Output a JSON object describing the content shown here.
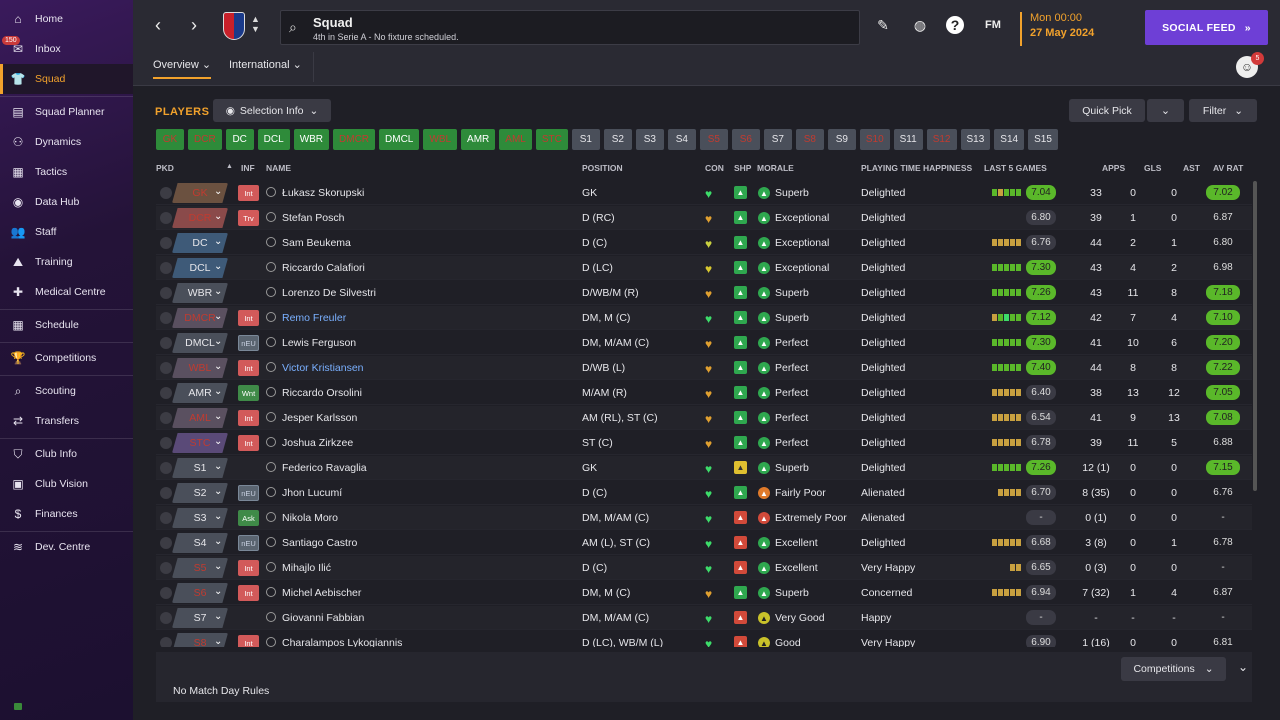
{
  "sidebar": {
    "items": [
      {
        "label": "Home",
        "icon": "home-icon",
        "glyph": "⌂"
      },
      {
        "label": "Inbox",
        "icon": "inbox-icon",
        "glyph": "✉",
        "badge": "150"
      },
      {
        "label": "Squad",
        "icon": "squad-icon",
        "glyph": "👕",
        "active": true
      },
      {
        "label": "Squad Planner",
        "icon": "planner-icon",
        "glyph": "▤"
      },
      {
        "label": "Dynamics",
        "icon": "dynamics-icon",
        "glyph": "⚇"
      },
      {
        "label": "Tactics",
        "icon": "tactics-icon",
        "glyph": "▦"
      },
      {
        "label": "Data Hub",
        "icon": "datahub-icon",
        "glyph": "◉"
      },
      {
        "label": "Staff",
        "icon": "staff-icon",
        "glyph": "👥"
      },
      {
        "label": "Training",
        "icon": "training-icon",
        "glyph": "⛰"
      },
      {
        "label": "Medical Centre",
        "icon": "medical-icon",
        "glyph": "✚"
      },
      {
        "label": "Schedule",
        "icon": "schedule-icon",
        "glyph": "▦"
      },
      {
        "label": "Competitions",
        "icon": "trophy-icon",
        "glyph": "🏆"
      },
      {
        "label": "Scouting",
        "icon": "scouting-icon",
        "glyph": "⌕"
      },
      {
        "label": "Transfers",
        "icon": "transfers-icon",
        "glyph": "⇄"
      },
      {
        "label": "Club Info",
        "icon": "shield-icon",
        "glyph": "⛉"
      },
      {
        "label": "Club Vision",
        "icon": "vision-icon",
        "glyph": "▣"
      },
      {
        "label": "Finances",
        "icon": "finances-icon",
        "glyph": "$"
      },
      {
        "label": "Dev. Centre",
        "icon": "devcentre-icon",
        "glyph": "≋"
      }
    ]
  },
  "header": {
    "title": "Squad",
    "subtitle": "4th in Serie A - No fixture scheduled.",
    "date_time": "Mon 00:00",
    "date": "27 May 2024",
    "social_feed": "SOCIAL FEED",
    "fm_label": "FM",
    "notif_count": "5"
  },
  "tabs": [
    "Overview",
    "International"
  ],
  "toolbar": {
    "players_label": "PLAYERS",
    "selection_info": "Selection Info",
    "quick_pick": "Quick Pick",
    "filter": "Filter"
  },
  "positions": [
    {
      "l": "GK",
      "s": "gr"
    },
    {
      "l": "DCR",
      "s": "gr"
    },
    {
      "l": "DC",
      "s": "g"
    },
    {
      "l": "DCL",
      "s": "g"
    },
    {
      "l": "WBR",
      "s": "g"
    },
    {
      "l": "DMCR",
      "s": "gr"
    },
    {
      "l": "DMCL",
      "s": "g"
    },
    {
      "l": "WBL",
      "s": "gr"
    },
    {
      "l": "AMR",
      "s": "g"
    },
    {
      "l": "AML",
      "s": "gr"
    },
    {
      "l": "STC",
      "s": "gr"
    },
    {
      "l": "S1",
      "s": "n"
    },
    {
      "l": "S2",
      "s": "n"
    },
    {
      "l": "S3",
      "s": "n"
    },
    {
      "l": "S4",
      "s": "n"
    },
    {
      "l": "S5",
      "s": "nr"
    },
    {
      "l": "S6",
      "s": "nr"
    },
    {
      "l": "S7",
      "s": "n"
    },
    {
      "l": "S8",
      "s": "nr"
    },
    {
      "l": "S9",
      "s": "n"
    },
    {
      "l": "S10",
      "s": "nr"
    },
    {
      "l": "S11",
      "s": "n"
    },
    {
      "l": "S12",
      "s": "nr"
    },
    {
      "l": "S13",
      "s": "n"
    },
    {
      "l": "S14",
      "s": "n"
    },
    {
      "l": "S15",
      "s": "n"
    }
  ],
  "columns": [
    "PKD",
    "INF",
    "NAME",
    "POSITION",
    "CON",
    "SHP",
    "MORALE",
    "PLAYING TIME HAPPINESS",
    "LAST 5 GAMES",
    "APPS",
    "GLS",
    "AST",
    "AV RAT"
  ],
  "players": [
    {
      "pkd": "GK",
      "pc": "pc-brown",
      "inf": "Int",
      "infc": "r",
      "name": "Łukasz Skorupski",
      "pos": "GK",
      "con": "#3ddc6a",
      "shp": "g",
      "mor": "Superb",
      "morc": "g",
      "happy": "Delighted",
      "bars": [
        "#5ab82a",
        "#c8a040",
        "#5ab82a",
        "#5ab82a",
        "#5ab82a"
      ],
      "rat": "7.04",
      "ratc": "g",
      "apps": "33",
      "gls": "0",
      "ast": "0",
      "av": "7.02",
      "avc": "g"
    },
    {
      "pkd": "DCR",
      "pc": "pc-red",
      "inf": "Trv",
      "infc": "r",
      "name": "Stefan Posch",
      "pos": "D (RC)",
      "con": "#e0a030",
      "shp": "g",
      "mor": "Exceptional",
      "morc": "g",
      "happy": "Delighted",
      "bars": [],
      "rat": "6.80",
      "ratc": "n",
      "apps": "39",
      "gls": "1",
      "ast": "0",
      "av": "6.87",
      "avc": "n"
    },
    {
      "pkd": "DC",
      "pc": "pc-blue",
      "inf": "",
      "infc": "",
      "name": "Sam Beukema",
      "pos": "D (C)",
      "con": "#c9d040",
      "shp": "g",
      "mor": "Exceptional",
      "morc": "g",
      "happy": "Delighted",
      "bars": [
        "#c8a040",
        "#c8a040",
        "#c8a040",
        "#c8a040",
        "#c8a040"
      ],
      "rat": "6.76",
      "ratc": "n",
      "apps": "44",
      "gls": "2",
      "ast": "1",
      "av": "6.80",
      "avc": "n"
    },
    {
      "pkd": "DCL",
      "pc": "pc-blue",
      "inf": "",
      "infc": "",
      "name": "Riccardo Calafiori",
      "pos": "D (LC)",
      "con": "#d8c830",
      "shp": "g",
      "mor": "Exceptional",
      "morc": "g",
      "happy": "Delighted",
      "bars": [
        "#5ab82a",
        "#5ab82a",
        "#5ab82a",
        "#5ab82a",
        "#5ab82a"
      ],
      "rat": "7.30",
      "ratc": "g",
      "apps": "43",
      "gls": "4",
      "ast": "2",
      "av": "6.98",
      "avc": "n"
    },
    {
      "pkd": "WBR",
      "pc": "pc-grey",
      "inf": "",
      "infc": "",
      "name": "Lorenzo De Silvestri",
      "pos": "D/WB/M (R)",
      "con": "#e0a030",
      "shp": "g",
      "mor": "Superb",
      "morc": "g",
      "happy": "Delighted",
      "bars": [
        "#5ab82a",
        "#5ab82a",
        "#5ab82a",
        "#5ab82a",
        "#5ab82a"
      ],
      "rat": "7.26",
      "ratc": "g",
      "apps": "43",
      "gls": "11",
      "ast": "8",
      "av": "7.18",
      "avc": "g"
    },
    {
      "pkd": "DMCR",
      "pc": "pc-redgrey",
      "inf": "Int",
      "infc": "r",
      "name": "Remo Freuler",
      "blue": true,
      "pos": "DM, M (C)",
      "con": "#3ddc6a",
      "shp": "g",
      "mor": "Superb",
      "morc": "g",
      "happy": "Delighted",
      "bars": [
        "#c8a040",
        "#5ab82a",
        "#3ddc6a",
        "#5ab82a",
        "#5ab82a"
      ],
      "rat": "7.12",
      "ratc": "g",
      "apps": "42",
      "gls": "7",
      "ast": "4",
      "av": "7.10",
      "avc": "g"
    },
    {
      "pkd": "DMCL",
      "pc": "pc-grey",
      "inf": "nEU",
      "infc": "b",
      "name": "Lewis Ferguson",
      "pos": "DM, M/AM (C)",
      "con": "#e0a030",
      "shp": "g",
      "mor": "Perfect",
      "morc": "g",
      "happy": "Delighted",
      "bars": [
        "#5ab82a",
        "#5ab82a",
        "#5ab82a",
        "#5ab82a",
        "#5ab82a"
      ],
      "rat": "7.30",
      "ratc": "g",
      "apps": "41",
      "gls": "10",
      "ast": "6",
      "av": "7.20",
      "avc": "g"
    },
    {
      "pkd": "WBL",
      "pc": "pc-redgrey",
      "inf": "Int",
      "infc": "r",
      "name": "Victor Kristiansen",
      "blue": true,
      "pos": "D/WB (L)",
      "con": "#e0a030",
      "shp": "g",
      "mor": "Perfect",
      "morc": "g",
      "happy": "Delighted",
      "bars": [
        "#5ab82a",
        "#5ab82a",
        "#5ab82a",
        "#5ab82a",
        "#5ab82a"
      ],
      "rat": "7.40",
      "ratc": "g",
      "apps": "44",
      "gls": "8",
      "ast": "8",
      "av": "7.22",
      "avc": "g"
    },
    {
      "pkd": "AMR",
      "pc": "pc-grey",
      "inf": "Wnt",
      "infc": "g",
      "name": "Riccardo Orsolini",
      "pos": "M/AM (R)",
      "con": "#e0a030",
      "shp": "g",
      "mor": "Perfect",
      "morc": "g",
      "happy": "Delighted",
      "bars": [
        "#c8a040",
        "#c8a040",
        "#c8a040",
        "#c8a040",
        "#c8a040"
      ],
      "rat": "6.40",
      "ratc": "n",
      "apps": "38",
      "gls": "13",
      "ast": "12",
      "av": "7.05",
      "avc": "g"
    },
    {
      "pkd": "AML",
      "pc": "pc-redgrey",
      "inf": "Int",
      "infc": "r",
      "name": "Jesper Karlsson",
      "pos": "AM (RL), ST (C)",
      "con": "#e0a030",
      "shp": "g",
      "mor": "Perfect",
      "morc": "g",
      "happy": "Delighted",
      "bars": [
        "#c8a040",
        "#c8a040",
        "#c8a040",
        "#c8a040",
        "#c8a040"
      ],
      "rat": "6.54",
      "ratc": "n",
      "apps": "41",
      "gls": "9",
      "ast": "13",
      "av": "7.08",
      "avc": "g"
    },
    {
      "pkd": "STC",
      "pc": "pc-purp",
      "inf": "Int",
      "infc": "r",
      "name": "Joshua Zirkzee",
      "pos": "ST (C)",
      "con": "#e0a030",
      "shp": "g",
      "mor": "Perfect",
      "morc": "g",
      "happy": "Delighted",
      "bars": [
        "#c8a040",
        "#c8a040",
        "#c8a040",
        "#c8a040",
        "#c8a040"
      ],
      "rat": "6.78",
      "ratc": "n",
      "apps": "39",
      "gls": "11",
      "ast": "5",
      "av": "6.88",
      "avc": "n"
    },
    {
      "pkd": "S1",
      "pc": "pc-grey",
      "inf": "",
      "infc": "",
      "name": "Federico Ravaglia",
      "pos": "GK",
      "con": "#3ddc6a",
      "shp": "y",
      "mor": "Superb",
      "morc": "g",
      "happy": "Delighted",
      "bars": [
        "#5ab82a",
        "#5ab82a",
        "#5ab82a",
        "#5ab82a",
        "#5ab82a"
      ],
      "rat": "7.26",
      "ratc": "g",
      "apps": "12 (1)",
      "gls": "0",
      "ast": "0",
      "av": "7.15",
      "avc": "g"
    },
    {
      "pkd": "S2",
      "pc": "pc-grey",
      "inf": "nEU",
      "infc": "b",
      "name": "Jhon Lucumí",
      "pos": "D (C)",
      "con": "#3ddc6a",
      "shp": "g",
      "mor": "Fairly Poor",
      "morc": "o",
      "happy": "Alienated",
      "bars": [
        "#c8a040",
        "#c8a040",
        "#c8a040",
        "#c8a040"
      ],
      "rat": "6.70",
      "ratc": "n",
      "apps": "8 (35)",
      "gls": "0",
      "ast": "0",
      "av": "6.76",
      "avc": "n"
    },
    {
      "pkd": "S3",
      "pc": "pc-grey",
      "inf": "Ask",
      "infc": "g",
      "name": "Nikola Moro",
      "pos": "DM, M/AM (C)",
      "con": "#3ddc6a",
      "shp": "r",
      "mor": "Extremely Poor",
      "morc": "r",
      "happy": "Alienated",
      "bars": [],
      "rat": "-",
      "ratc": "n",
      "apps": "0 (1)",
      "gls": "0",
      "ast": "0",
      "av": "-",
      "avc": "n"
    },
    {
      "pkd": "S4",
      "pc": "pc-grey",
      "inf": "nEU",
      "infc": "b",
      "name": "Santiago Castro",
      "pos": "AM (L), ST (C)",
      "con": "#3ddc6a",
      "shp": "r",
      "mor": "Excellent",
      "morc": "g",
      "happy": "Delighted",
      "bars": [
        "#c8a040",
        "#c8a040",
        "#c8a040",
        "#c8a040",
        "#c8a040"
      ],
      "rat": "6.68",
      "ratc": "n",
      "apps": "3 (8)",
      "gls": "0",
      "ast": "1",
      "av": "6.78",
      "avc": "n"
    },
    {
      "pkd": "S5",
      "pc": "pc-grey2",
      "inf": "Int",
      "infc": "r",
      "name": "Mihajlo Ilić",
      "pos": "D (C)",
      "con": "#3ddc6a",
      "shp": "r",
      "mor": "Excellent",
      "morc": "g",
      "happy": "Very Happy",
      "bars": [
        "#c8a040",
        "#c8a040"
      ],
      "rat": "6.65",
      "ratc": "n",
      "apps": "0 (3)",
      "gls": "0",
      "ast": "0",
      "av": "-",
      "avc": "n"
    },
    {
      "pkd": "S6",
      "pc": "pc-grey2",
      "inf": "Int",
      "infc": "r",
      "name": "Michel Aebischer",
      "pos": "DM, M (C)",
      "con": "#e0a030",
      "shp": "g",
      "mor": "Superb",
      "morc": "g",
      "happy": "Concerned",
      "bars": [
        "#c8a040",
        "#c8a040",
        "#c8a040",
        "#c8a040",
        "#c8a040"
      ],
      "rat": "6.94",
      "ratc": "n",
      "apps": "7 (32)",
      "gls": "1",
      "ast": "4",
      "av": "6.87",
      "avc": "n"
    },
    {
      "pkd": "S7",
      "pc": "pc-grey",
      "inf": "",
      "infc": "",
      "name": "Giovanni Fabbian",
      "pos": "DM, M/AM (C)",
      "con": "#3ddc6a",
      "shp": "r",
      "mor": "Very Good",
      "morc": "y",
      "happy": "Happy",
      "bars": [],
      "rat": "-",
      "ratc": "n",
      "apps": "-",
      "gls": "-",
      "ast": "-",
      "av": "-",
      "avc": "n"
    },
    {
      "pkd": "S8",
      "pc": "pc-grey2",
      "inf": "Int",
      "infc": "r",
      "name": "Charalampos Lykogiannis",
      "pos": "D (LC), WB/M (L)",
      "con": "#3ddc6a",
      "shp": "r",
      "mor": "Good",
      "morc": "y",
      "happy": "Very Happy",
      "bars": [],
      "rat": "6.90",
      "ratc": "n",
      "apps": "1 (16)",
      "gls": "0",
      "ast": "0",
      "av": "6.81",
      "avc": "n"
    }
  ],
  "bottom": {
    "rules": "No Match Day Rules",
    "competitions": "Competitions"
  }
}
